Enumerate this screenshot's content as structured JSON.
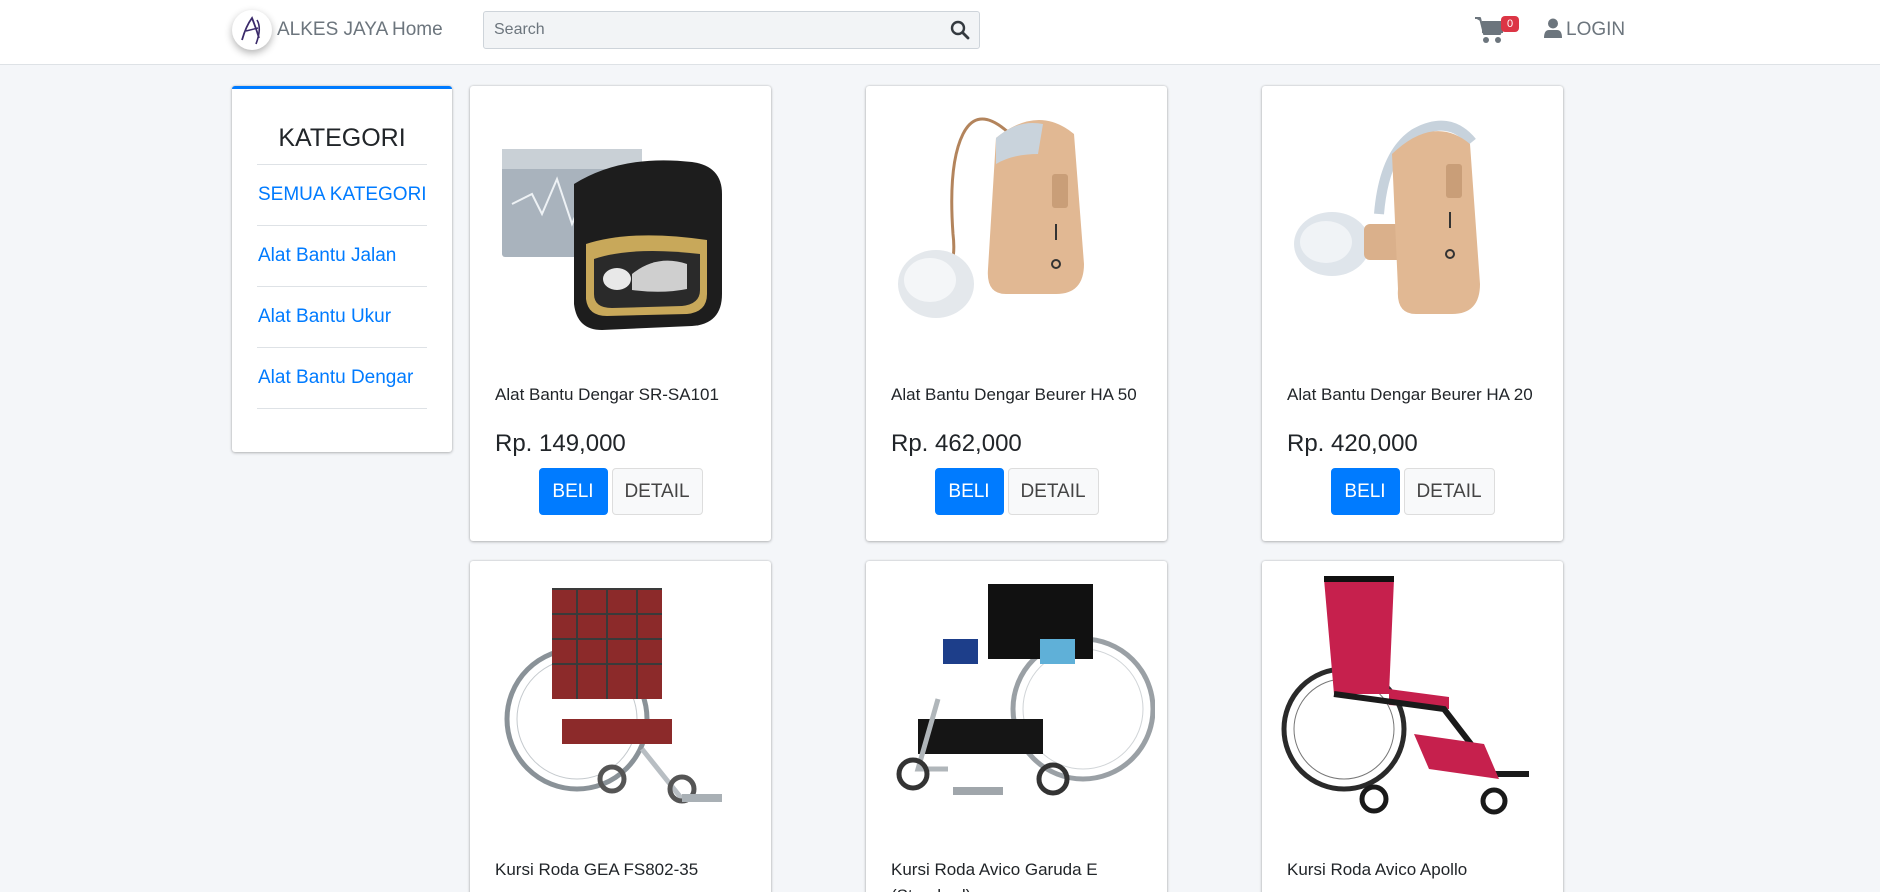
{
  "header": {
    "brand": "ALKES JAYA",
    "home_label": "Home",
    "search_placeholder": "Search",
    "cart_count": "0",
    "login_label": "LOGIN"
  },
  "sidebar": {
    "title": "KATEGORI",
    "items": [
      {
        "label": "SEMUA KATEGORI"
      },
      {
        "label": "Alat Bantu Jalan"
      },
      {
        "label": "Alat Bantu Ukur"
      },
      {
        "label": "Alat Bantu Dengar"
      }
    ]
  },
  "products": [
    {
      "name": "Alat Bantu Dengar SR-SA101",
      "price": "Rp. 149,000",
      "buy_label": "BELI",
      "detail_label": "DETAIL",
      "image": "hearing-aid-case-image"
    },
    {
      "name": "Alat Bantu Dengar Beurer HA 50",
      "price": "Rp. 462,000",
      "buy_label": "BELI",
      "detail_label": "DETAIL",
      "image": "hearing-aid-image"
    },
    {
      "name": "Alat Bantu Dengar Beurer HA 20",
      "price": "Rp. 420,000",
      "buy_label": "BELI",
      "detail_label": "DETAIL",
      "image": "hearing-aid-image"
    },
    {
      "name": "Kursi Roda GEA FS802-35",
      "image": "wheelchair-image"
    },
    {
      "name": "Kursi Roda Avico Garuda E (Standard)",
      "image": "wheelchair-image"
    },
    {
      "name": "Kursi Roda Avico Apollo",
      "image": "wheelchair-image"
    }
  ],
  "colors": {
    "accent": "#007bff",
    "badge": "#dc3545",
    "background": "#f4f6f9"
  }
}
